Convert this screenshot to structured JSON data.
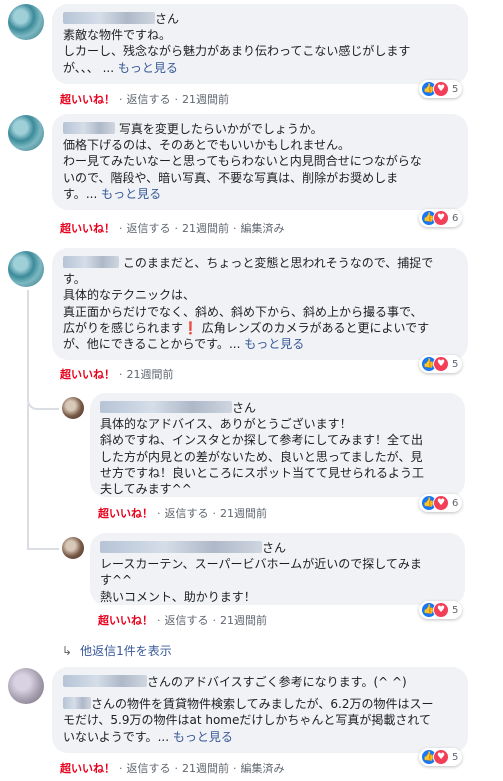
{
  "comments": [
    {
      "name_suffix": "さん",
      "lines": [
        "素敵な物件ですね。",
        "しカーし、残念ながら魅力があまり伝わってこない感じがします",
        "が、、、"
      ],
      "more": "もっと見る",
      "like": "超いいね！",
      "reply": "返信する",
      "time": "21週間前",
      "reactions": "5"
    },
    {
      "lines": [
        "写真を変更したらいかがでしょうか。",
        "価格下げるのは、そのあとでもいいかもしれません。",
        "わー見てみたいなーと思ってもらわないと内見問合せにつながらな",
        "いので、階段や、暗い写真、不要な写真は、削除がお奨めしま",
        "す。"
      ],
      "more": "もっと見る",
      "like": "超いいね！",
      "reply": "返信する",
      "time": "21週間前",
      "edited": "編集済み",
      "reactions": "6"
    },
    {
      "lines": [
        "このままだと、ちょっと変態と思われそうなので、捕捉で",
        "す。",
        "具体的なテクニックは、",
        "真正面からだけでなく、斜め、斜め下から、斜め上から撮る事で、",
        "広がりを感じられます❗ 広角レンズのカメラがあると更によいです",
        "が、他にできることからです。"
      ],
      "more": "もっと見る",
      "like": "超いいね！",
      "time": "21週間前",
      "reactions": "5"
    }
  ],
  "replies": [
    {
      "name_suffix": "さん",
      "lines": [
        "具体的なアドバイス、ありがとうございます！",
        "斜めですね、インスタとか探して参考にしてみます！全て出",
        "した方が内見との差がないため、良いと思ってましたが、見",
        "せ方ですね！良いところにスポット当てて見せられるよう工",
        "夫してみます^^"
      ],
      "like": "超いいね！",
      "reply": "返信する",
      "time": "21週間前",
      "reactions": "6"
    },
    {
      "name_suffix": "さん",
      "lines": [
        "レースカーテン、スーパービバホームが近いので探してみま",
        "す^^",
        "熱いコメント、助かります！"
      ],
      "like": "超いいね！",
      "reply": "返信する",
      "time": "21週間前",
      "reactions": "5"
    }
  ],
  "more_replies": "他返信1件を表示",
  "last_comment": {
    "line1": "さんのアドバイスすごく参考になります。(^ ^)",
    "line2": "さんの物件を賃貸物件検索してみましたが、6.2万の物件はスー",
    "line3": "モだけ、5.9万の物件はat homeだけしかちゃんと写真が掲載されて",
    "line4": "いないようです。",
    "more": "もっと見る",
    "like": "超いいね！",
    "reply": "返信する",
    "time": "21週間前",
    "edited": "編集済み",
    "reactions": "5"
  },
  "glyphs": {
    "like": "👍",
    "love": "♥",
    "arrow": "↳",
    "ellipsis": "...",
    "dot": "·"
  }
}
